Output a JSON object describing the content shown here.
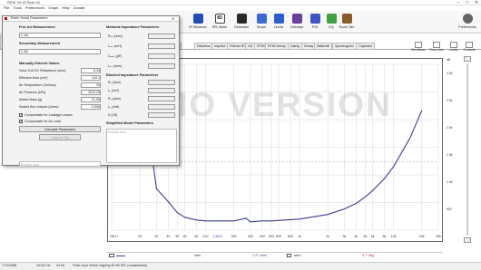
{
  "window": {
    "title": "REW V5.20 Beta 34",
    "minimize": "–",
    "maximize": "□",
    "close": "✕"
  },
  "menu": [
    "File",
    "Tools",
    "Preferences",
    "Graph",
    "Help",
    "Donate"
  ],
  "toolbar": {
    "left": "Measure",
    "tools": [
      {
        "label": "IR Windows",
        "icon": "ir-windows-icon",
        "color": "#1f4fb5"
      },
      {
        "label": "SPL Meter",
        "icon": "spl-meter-icon",
        "value": "83",
        "color": "#111"
      },
      {
        "label": "Generator",
        "icon": "generator-icon",
        "color": "#2a2a2a"
      },
      {
        "label": "Scope",
        "icon": "scope-icon",
        "color": "#3a6ad6"
      },
      {
        "label": "Levels",
        "icon": "levels-icon",
        "color": "#2b5fd0"
      },
      {
        "label": "Overlays",
        "icon": "overlays-icon",
        "color": "#6a3fa0"
      },
      {
        "label": "RTA",
        "icon": "rta-icon",
        "color": "#3c57c4"
      },
      {
        "label": "EQ",
        "icon": "eq-icon",
        "color": "#3ea03e"
      },
      {
        "label": "Room Sim",
        "icon": "room-sim-icon",
        "color": "#8a5a2a"
      }
    ],
    "preferences": "Preferences"
  },
  "tabs": [
    "Impedance",
    "Distortion",
    "Impulse",
    "Filtered IR",
    "GD",
    "RT60",
    "RT60 Decay",
    "Clarity",
    "Decay",
    "Waterfall",
    "Spectrogram",
    "Captured"
  ],
  "left_tabs": [
    "Meas",
    "Imp"
  ],
  "right_controls": [
    "Scrollbars",
    "Freq. Axis",
    "Limits",
    "Controls"
  ],
  "graph": {
    "x_ticks": [
      "10",
      "20",
      "30",
      "40",
      "50",
      "60",
      "80",
      "100",
      "200",
      "300",
      "400",
      "500",
      "600",
      "800",
      "1k",
      "2k",
      "3k",
      "4k",
      "5k",
      "6k",
      "8k",
      "10k",
      "20k",
      "30k"
    ],
    "db_axis": [
      "dB",
      "3.0k",
      "2.5k",
      "2.0k",
      "1.5k",
      "1.0k",
      "500"
    ],
    "x_marker": "1:00.0",
    "y_marker": "1.01",
    "freq_marker": "13.7"
  },
  "chart_data": {
    "type": "line",
    "series": [
      {
        "values": [
          [
            10,
            9
          ],
          [
            20,
            5
          ],
          [
            30,
            0.45
          ],
          [
            40,
            0.31
          ],
          [
            50,
            0.19
          ],
          [
            60,
            0.14
          ],
          [
            80,
            0.11
          ],
          [
            100,
            0.1
          ],
          [
            200,
            0.1
          ],
          [
            270,
            0.13
          ],
          [
            300,
            0.09
          ],
          [
            400,
            0.1
          ],
          [
            500,
            0.1
          ],
          [
            1000,
            0.12
          ],
          [
            2000,
            0.17
          ],
          [
            3000,
            0.23
          ],
          [
            4000,
            0.29
          ],
          [
            5000,
            0.36
          ],
          [
            6000,
            0.43
          ],
          [
            8000,
            0.56
          ],
          [
            10000,
            0.69
          ],
          [
            15000,
            1.0
          ],
          [
            20000,
            1.3
          ]
        ]
      }
    ],
    "xscale": "log",
    "xlim": [
      10,
      30000
    ]
  },
  "legend": {
    "channel": "1ms",
    "value": "7.27 ohm",
    "phase_label": "ohm",
    "phase": "-4.7 deg"
  },
  "status": {
    "memory": "77/242MB",
    "rate": "44100 Hz",
    "bits": "24 bit",
    "message": "Peak input before clipping 95 dB SPL (uncalibrated)"
  },
  "dialog": {
    "title": "Thiele Small Parameters",
    "free_air": {
      "label": "Free Air Measurement",
      "value": "2 1ld"
    },
    "secondary": {
      "label": "Secondary Measurement",
      "value": "2 3ld"
    },
    "manual": {
      "label": "Manually Entered Values",
      "rows": [
        {
          "label": "Voice Coil DC Resistance (ohm)",
          "value": "6.34"
        },
        {
          "label": "Effective Area (cm²)",
          "value": "143.1"
        },
        {
          "label": "Air Temperature (Celsius)",
          "value": "20"
        },
        {
          "label": "Air Pressure (kPa)",
          "value": "1013.25"
        },
        {
          "label": "Added Mass (g)",
          "value": "31.00"
        },
        {
          "label": "Sealed Box Volume (Litres)",
          "value": "0.000"
        }
      ]
    },
    "checks": [
      {
        "label": "Compensate for Leakage Losses",
        "checked": true
      },
      {
        "label": "Compensate for Air Load",
        "checked": true
      }
    ],
    "calc_button": "Calculate Parameters",
    "copy_button": "Copy to Clip",
    "results_placeholder": "Results area",
    "motional": {
      "label": "Motional Impedance Parameters",
      "rows": [
        "Rₑₛ (ohm)",
        "Lₐₑₛ (mH)",
        "Cₘₑₛ (µF)",
        "Lₑₛ (ohm)"
      ]
    },
    "blocked": {
      "label": "Blocked Impedance Parameters",
      "rows": [
        "Rₑ (ohm)",
        "L₁ (mH)",
        "R₂ (ohm)",
        "L₂ (mH)",
        "K (LR)"
      ]
    },
    "simplified": {
      "label": "Simplified Model Parameters",
      "placeholder": "Results area"
    }
  },
  "watermark": "DEMO VERSION"
}
